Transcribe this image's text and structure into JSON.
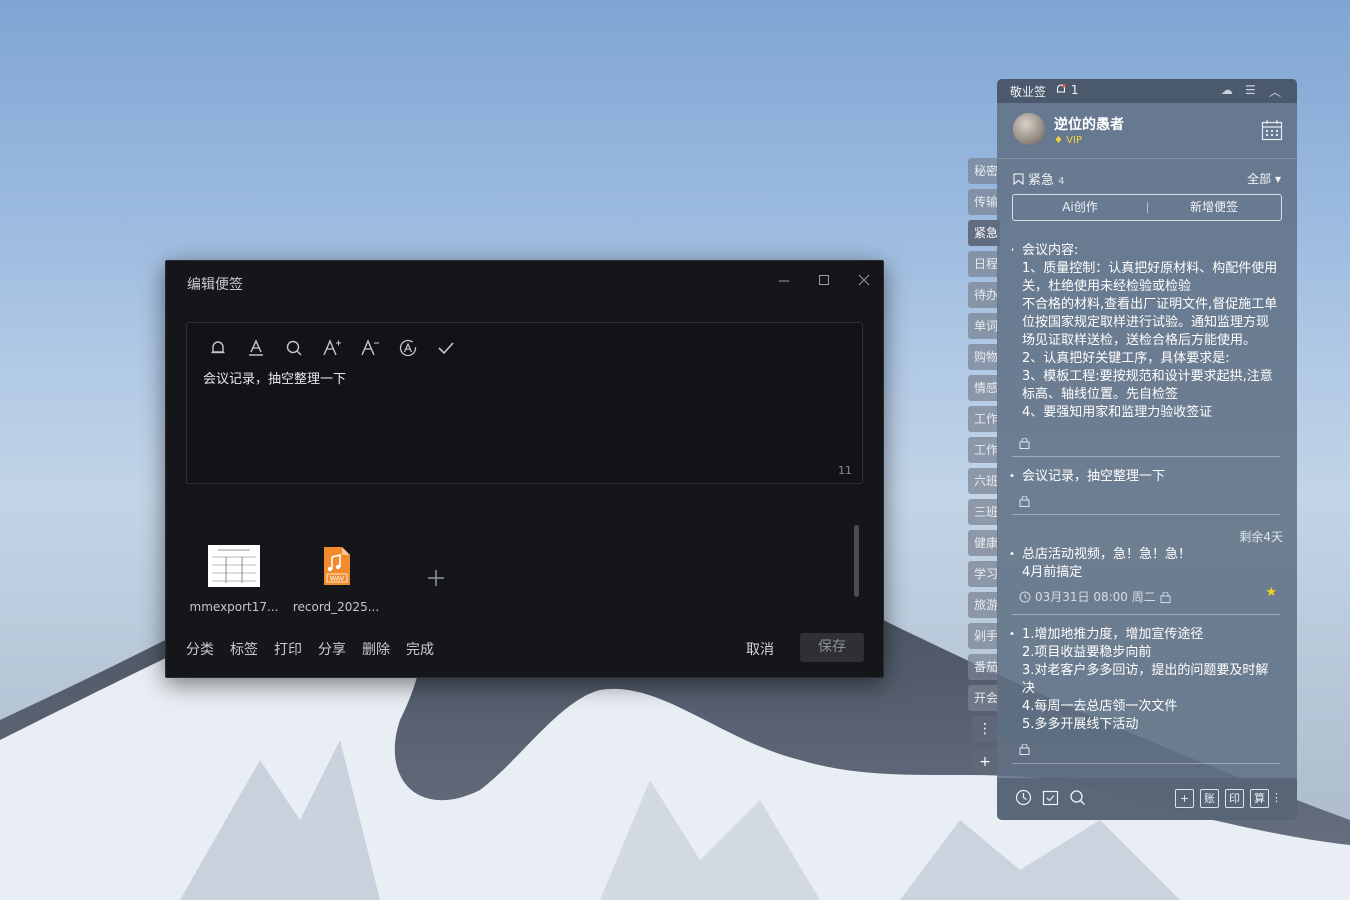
{
  "dialog": {
    "title": "编辑便签",
    "editor_text": "会议记录，抽空整理一下",
    "char_count": "11",
    "attachments": [
      {
        "name": "mmexport17..."
      },
      {
        "name": "record_2025..."
      }
    ],
    "wav_label": "WAV",
    "actions": [
      "分类",
      "标签",
      "打印",
      "分享",
      "删除",
      "完成"
    ],
    "cancel_label": "取消",
    "save_label": "保存"
  },
  "sidetabs": [
    "秘密",
    "传输",
    "紧急",
    "日程",
    "待办",
    "单词",
    "购物",
    "情感",
    "工作",
    "工作",
    "六班",
    "三班",
    "健康",
    "学习",
    "旅游",
    "剁手",
    "番茄",
    "开会"
  ],
  "panel": {
    "app_name": "敬业签",
    "notify_count": "1",
    "username": "逆位的愚者",
    "vip": "VIP",
    "category": "紧急",
    "category_count": "4",
    "filter": "全部",
    "ai_button": "Ai创作",
    "new_button": "新增便签",
    "notes": [
      {
        "text": "会议内容:\n1、质量控制：认真把好原材料、构配件使用关，杜绝使用未经检验或检验\n不合格的材料,查看出厂证明文件,督促施工单位按国家规定取样进行试验。通知监理方现场见证取样送检，送检合格后方能使用。\n2、认真把好关键工序，具体要求是:\n3、模板工程:要按规范和设计要求起拱,注意标高、轴线位置。先自检签\n4、要强知用家和监理力验收签证"
      },
      {
        "text": "会议记录，抽空整理一下"
      },
      {
        "remaining": "剩余4天",
        "text": "总店活动视频，急！急！急！\n4月前搞定",
        "time": "03月31日 08:00 周二"
      },
      {
        "text": "1.增加地推力度，增加宣传途径\n2.项目收益要稳步向前\n3.对老客户多多回访，提出的问题要及时解决\n4.每周一去总店领一次文件\n5.多多开展线下活动"
      }
    ],
    "bottom_tools": [
      "账",
      "印",
      "算"
    ]
  }
}
